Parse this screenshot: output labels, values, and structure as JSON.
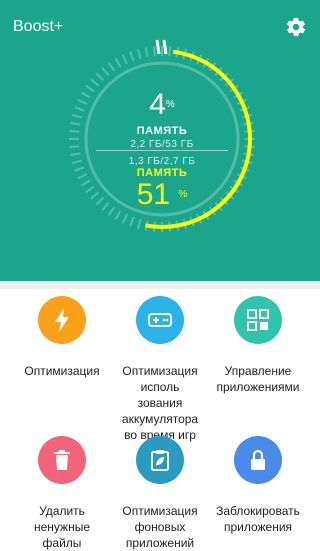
{
  "app": {
    "title": "Boost+"
  },
  "colors": {
    "hero_bg": "#1ba58c",
    "gauge_active": "#ffff00",
    "optimize": "#f7a21a",
    "game_boost": "#2ab3e6",
    "apps_manager": "#30c4ad",
    "junk": "#f2647a",
    "background_apps": "#2b9ac1",
    "app_lock": "#4a8ae8"
  },
  "storage": {
    "used_value": "4",
    "used_unit": "%",
    "label": "ПАМЯТЬ",
    "detail": "2,2 ГБ/53 ГБ"
  },
  "ram": {
    "detail": "1,3 ГБ/2,7 ГБ",
    "label": "ПАМЯТЬ",
    "free_value": "51",
    "free_unit": "%",
    "gauge_fraction": 0.51
  },
  "tiles": [
    {
      "label": "Оптимизация",
      "icon": "lightning-icon"
    },
    {
      "label": "Оптимизация\nисполь\nзования\nаккумулятора\nво время игр",
      "icon": "gamepad-icon"
    },
    {
      "label": "Управление\nприложениями",
      "icon": "grid-icon"
    },
    {
      "label": "Удалить\nненужные\nфайлы",
      "icon": "trash-icon"
    },
    {
      "label": "Оптимизация\nфоновых\nприложений",
      "icon": "leaf-clipboard-icon"
    },
    {
      "label": "Заблокировать\nприложения",
      "icon": "lock-icon"
    }
  ]
}
